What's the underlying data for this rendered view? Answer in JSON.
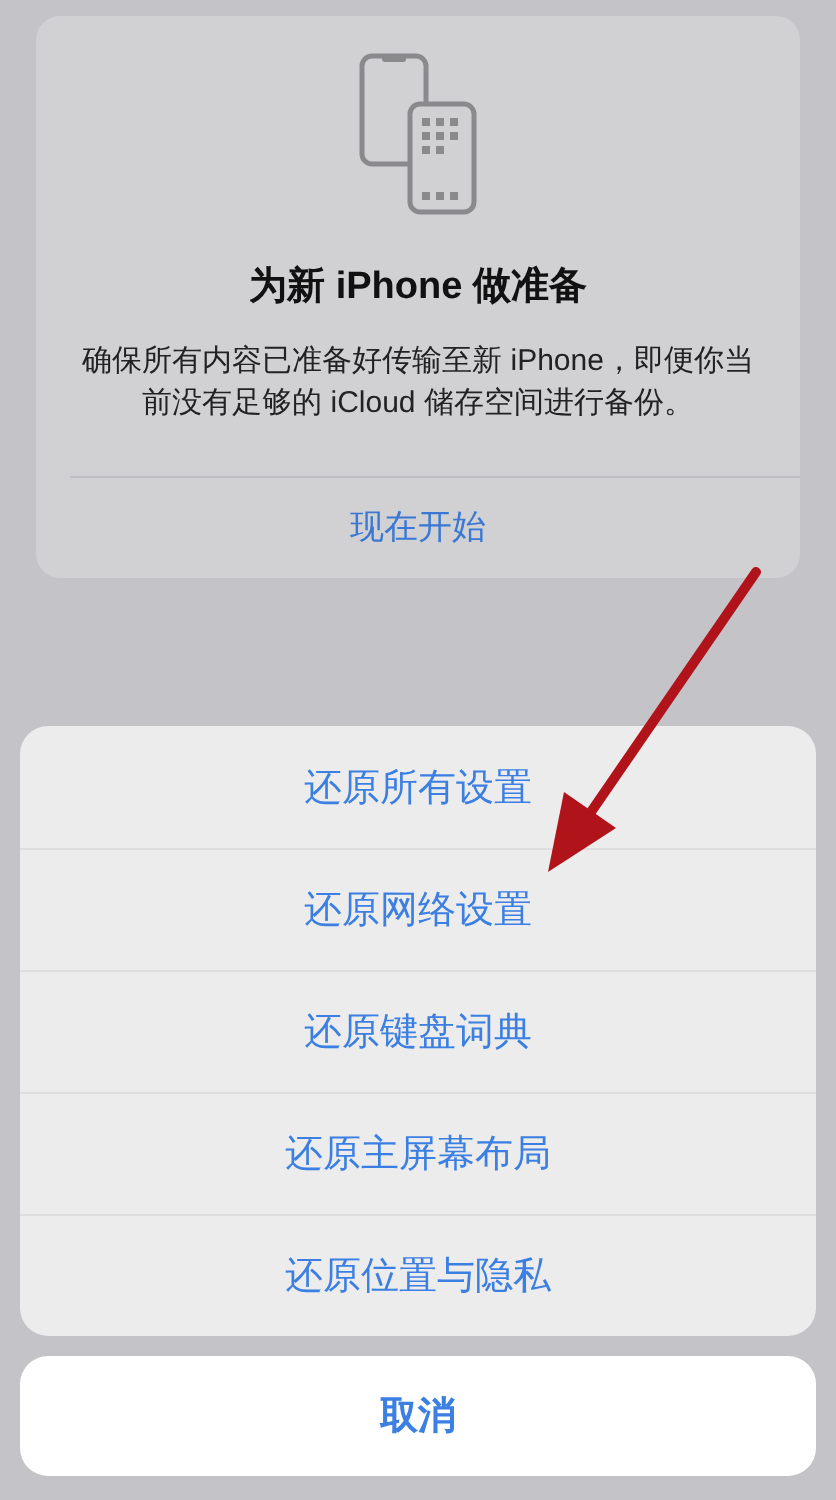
{
  "card": {
    "title": "为新 iPhone 做准备",
    "description": "确保所有内容已准备好传输至新 iPhone，即便你当前没有足够的 iCloud 储存空间进行备份。",
    "action": "现在开始"
  },
  "action_sheet": {
    "options": [
      {
        "label": "还原所有设置"
      },
      {
        "label": "还原网络设置"
      },
      {
        "label": "还原键盘词典"
      },
      {
        "label": "还原主屏幕布局"
      },
      {
        "label": "还原位置与隐私"
      }
    ],
    "cancel": "取消"
  }
}
